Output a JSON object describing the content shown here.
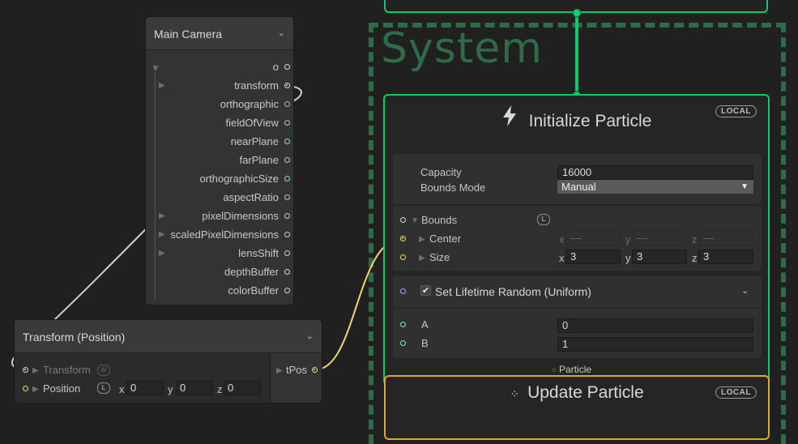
{
  "system": {
    "title": "System"
  },
  "init_context": {
    "title": "Initialize Particle",
    "badge": "LOCAL",
    "capacity_label": "Capacity",
    "capacity_value": "16000",
    "bounds_mode_label": "Bounds Mode",
    "bounds_mode_value": "Manual",
    "bounds_label": "Bounds",
    "bounds_badge": "L",
    "center_label": "Center",
    "center": {
      "x_label": "x",
      "x": "—",
      "y_label": "y",
      "y": "—",
      "z_label": "z",
      "z": "—"
    },
    "size_label": "Size",
    "size": {
      "x_label": "x",
      "x": "3",
      "y_label": "y",
      "y": "3",
      "z_label": "z",
      "z": "3"
    },
    "block_title": "Set Lifetime Random (Uniform)",
    "a_label": "A",
    "a_value": "0",
    "b_label": "B",
    "b_value": "1",
    "particle_label": "Particle"
  },
  "update_context": {
    "title": "Update Particle",
    "badge": "LOCAL"
  },
  "camera_node": {
    "title": "Main Camera",
    "rows": [
      "o",
      "transform",
      "orthographic",
      "fieldOfView",
      "nearPlane",
      "farPlane",
      "orthographicSize",
      "aspectRatio",
      "pixelDimensions",
      "scaledPixelDimensions",
      "lensShift",
      "depthBuffer",
      "colorBuffer"
    ]
  },
  "transform_node": {
    "title": "Transform (Position)",
    "transform_label": "Transform",
    "transform_badge": "W",
    "position_label": "Position",
    "position_badge": "L",
    "x_label": "x",
    "x": "0",
    "y_label": "y",
    "y": "0",
    "z_label": "z",
    "z": "0",
    "output_label": "tPos"
  },
  "colors": {
    "context_border": "#14c76a",
    "update_border": "#e0a828",
    "system_dash": "#2f6b47",
    "wire_yellow": "#f2d76a"
  }
}
